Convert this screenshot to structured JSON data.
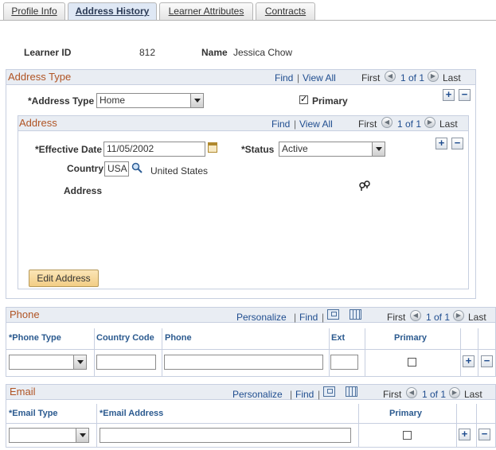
{
  "tabs": [
    {
      "label": "Profile Info"
    },
    {
      "label": "Address History"
    },
    {
      "label": "Learner Attributes"
    },
    {
      "label": "Contracts"
    }
  ],
  "learner": {
    "id_label": "Learner ID",
    "id_value": "812",
    "name_label": "Name",
    "name_value": "Jessica Chow"
  },
  "address_type_box": {
    "title": "Address Type",
    "find": "Find",
    "view_all": "View All",
    "first": "First",
    "count": "1 of 1",
    "last": "Last",
    "type_label": "*Address Type",
    "type_value": "Home",
    "primary_label": "Primary",
    "primary_checked": "✓"
  },
  "address_box": {
    "title": "Address",
    "find": "Find",
    "view_all": "View All",
    "first": "First",
    "count": "1 of 1",
    "last": "Last",
    "effdt_label": "*Effective Date",
    "effdt_value": "11/05/2002",
    "status_label": "*Status",
    "status_value": "Active",
    "country_label": "Country",
    "country_value": "USA",
    "country_desc": "United States",
    "address_label": "Address",
    "edit_button": "Edit Address"
  },
  "phone_box": {
    "title": "Phone",
    "personalize": "Personalize",
    "find": "Find",
    "first": "First",
    "count": "1 of 1",
    "last": "Last",
    "columns": [
      "*Phone Type",
      "Country Code",
      "Phone",
      "Ext",
      "Primary"
    ]
  },
  "email_box": {
    "title": "Email",
    "personalize": "Personalize",
    "find": "Find",
    "first": "First",
    "count": "1 of 1",
    "last": "Last",
    "columns": [
      "*Email Type",
      "*Email Address",
      "Primary"
    ]
  },
  "buttons": {
    "add": "+",
    "delete": "−"
  },
  "colors": {
    "link": "#1f4d8f",
    "group_title": "#b05424",
    "grid_header": "#2b5a8f"
  }
}
